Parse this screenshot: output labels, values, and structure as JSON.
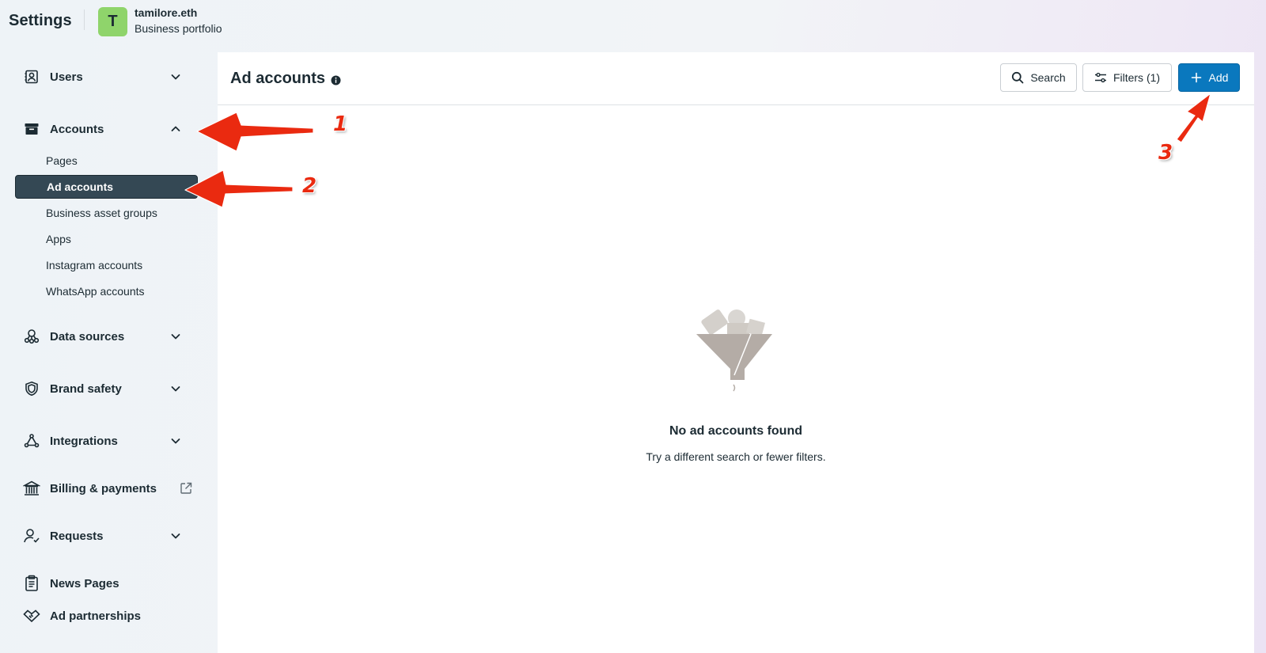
{
  "header": {
    "app_title": "Settings",
    "portfolio": {
      "avatar_letter": "T",
      "avatar_color": "#8fd46b",
      "name": "tamilore.eth",
      "type": "Business portfolio"
    }
  },
  "sidebar": {
    "sections": [
      {
        "label": "Users",
        "icon": "users-icon",
        "expanded": false
      },
      {
        "label": "Accounts",
        "icon": "accounts-box-icon",
        "expanded": true
      },
      {
        "label": "Data sources",
        "icon": "data-sources-icon",
        "expanded": false
      },
      {
        "label": "Brand safety",
        "icon": "shield-icon",
        "expanded": false
      },
      {
        "label": "Integrations",
        "icon": "integrations-icon",
        "expanded": false
      },
      {
        "label": "Billing & payments",
        "icon": "bank-icon",
        "external": true
      },
      {
        "label": "Requests",
        "icon": "user-check-icon",
        "expanded": false
      },
      {
        "label": "News Pages",
        "icon": "clipboard-icon"
      },
      {
        "label": "Ad partnerships",
        "icon": "handshake-icon"
      }
    ],
    "accounts_items": [
      {
        "label": "Pages",
        "active": false
      },
      {
        "label": "Ad accounts",
        "active": true
      },
      {
        "label": "Business asset groups",
        "active": false
      },
      {
        "label": "Apps",
        "active": false
      },
      {
        "label": "Instagram accounts",
        "active": false
      },
      {
        "label": "WhatsApp accounts",
        "active": false
      }
    ]
  },
  "main": {
    "title": "Ad accounts",
    "toolbar": {
      "search_label": "Search",
      "filters_label": "Filters (1)",
      "add_label": "Add"
    },
    "empty_state": {
      "title": "No ad accounts found",
      "subtitle": "Try a different search or fewer filters."
    }
  },
  "annotations": {
    "labels": [
      "1",
      "2",
      "3"
    ],
    "color": "#ea2a10"
  },
  "colors": {
    "primary": "#0a78be",
    "active_nav": "#344854",
    "text": "#1c2b33"
  }
}
